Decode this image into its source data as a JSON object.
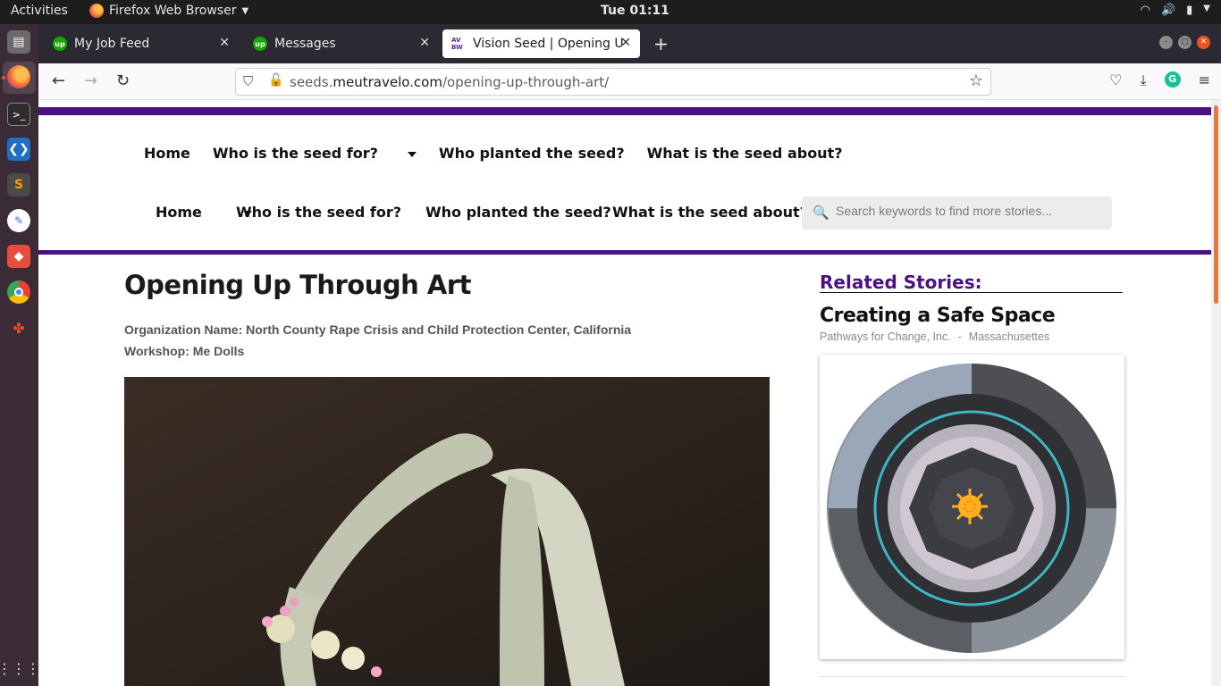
{
  "system": {
    "activities": "Activities",
    "app_name": "Firefox Web Browser",
    "clock": "Tue 01:11"
  },
  "tabs": [
    {
      "label": "My Job Feed",
      "favicon": "upwork-icon"
    },
    {
      "label": "Messages",
      "favicon": "upwork-icon"
    },
    {
      "label": "Vision Seed | Opening Up",
      "favicon": "avw-icon",
      "selected": true
    }
  ],
  "url": {
    "prefix": "seeds.",
    "host": "meutravelo.com",
    "path": "/opening-up-through-art/"
  },
  "menu_top": {
    "home": "Home",
    "who_for": "Who is the seed for?",
    "who_planted": "Who planted the seed?",
    "what_about": "What is the seed about?"
  },
  "menu_main": {
    "home": "Home",
    "who_for": "Who is the seed for?",
    "who_planted": "Who planted the seed?",
    "what_about": "What is the seed about?"
  },
  "search": {
    "placeholder": "Search keywords to find more stories..."
  },
  "article": {
    "title": "Opening Up Through Art",
    "organization": "Organization Name: North County Rape Crisis and Child Protection Center, California",
    "workshop": "Workshop: Me Dolls"
  },
  "related": {
    "heading": "Related Stories:",
    "story_title": "Creating a Safe Space",
    "story_org": "Pathways for Change, Inc.",
    "story_sep": "-",
    "story_state": "Massachusettes"
  },
  "colors": {
    "brand_purple": "#4b0f86",
    "dock": "#3b2b37",
    "ubuntu_orange": "#e95420"
  }
}
